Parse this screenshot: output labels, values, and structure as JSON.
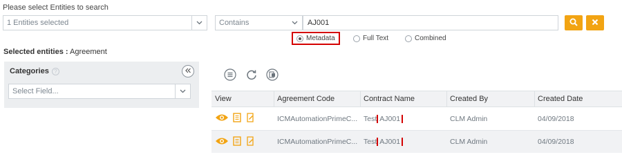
{
  "search": {
    "prompt": "Please select Entities to search",
    "entities_value": "1 Entities selected",
    "operator_value": "Contains",
    "query_value": "AJ001",
    "search_options": [
      "Metadata",
      "Full Text",
      "Combined"
    ],
    "selected_option": "Metadata"
  },
  "selected_entities": {
    "label": "Selected entities :",
    "value": "Agreement"
  },
  "categories": {
    "title": "Categories",
    "help_glyph": "?",
    "field_placeholder": "Select Field..."
  },
  "grid": {
    "columns": [
      "View",
      "Agreement Code",
      "Contract Name",
      "Created By",
      "Created Date"
    ],
    "rows": [
      {
        "agreement_code": "ICMAutomationPrimeC...",
        "contract_prefix": "Test",
        "contract_match": "AJ001",
        "created_by": "CLM Admin",
        "created_date": "04/09/2018"
      },
      {
        "agreement_code": "ICMAutomationPrimeC...",
        "contract_prefix": "Test",
        "contract_match": "AJ001",
        "created_by": "CLM Admin",
        "created_date": "04/09/2018"
      }
    ]
  },
  "icons": {
    "search": "search-icon",
    "clear": "close-icon",
    "collapse": "double-chevron-left-icon",
    "list": "list-icon",
    "refresh": "refresh-icon",
    "export": "export-icon",
    "view": "eye-icon",
    "details": "document-icon",
    "edit": "edit-document-icon"
  },
  "colors": {
    "accent": "#f2a413",
    "highlight_border": "#d40000"
  }
}
